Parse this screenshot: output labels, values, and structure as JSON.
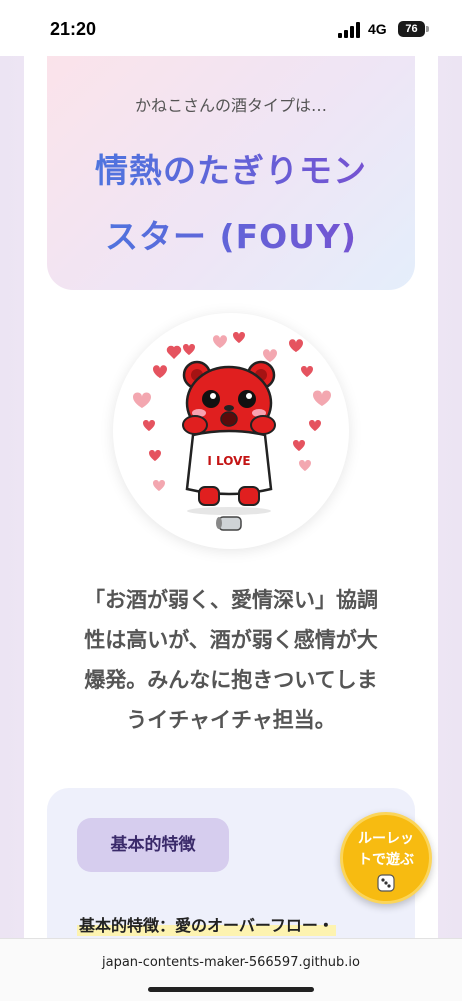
{
  "status_bar": {
    "time": "21:20",
    "network": "4G",
    "battery": "76"
  },
  "result": {
    "intro": "かねこさんの酒タイプは…",
    "title_line1": "情熱のたぎりモン",
    "title_line2": "スター (FOUY)"
  },
  "mascot": {
    "shirt_text": "I LOVE",
    "icon": "red-bear-mascot-icon"
  },
  "description": {
    "line1": "「お酒が弱く、愛情深い」協調",
    "line2": "性は高いが、酒が弱く感情が大",
    "line3": "爆発。みんなに抱きついてしま",
    "line4": "うイチャイチャ担当。"
  },
  "features": {
    "tag": "基本的特徴",
    "line": "基本的特徴：愛のオーバーフロー・"
  },
  "roulette": {
    "line1": "ルーレッ",
    "line2": "トで遊ぶ",
    "icon": "dice-icon"
  },
  "browser": {
    "url": "japan-contents-maker-566597.github.io"
  },
  "colors": {
    "title_gradient_start": "#4a78e0",
    "title_gradient_end": "#7a4fd0",
    "roulette": "#f7bb11",
    "mascot_red": "#e01f1f"
  }
}
